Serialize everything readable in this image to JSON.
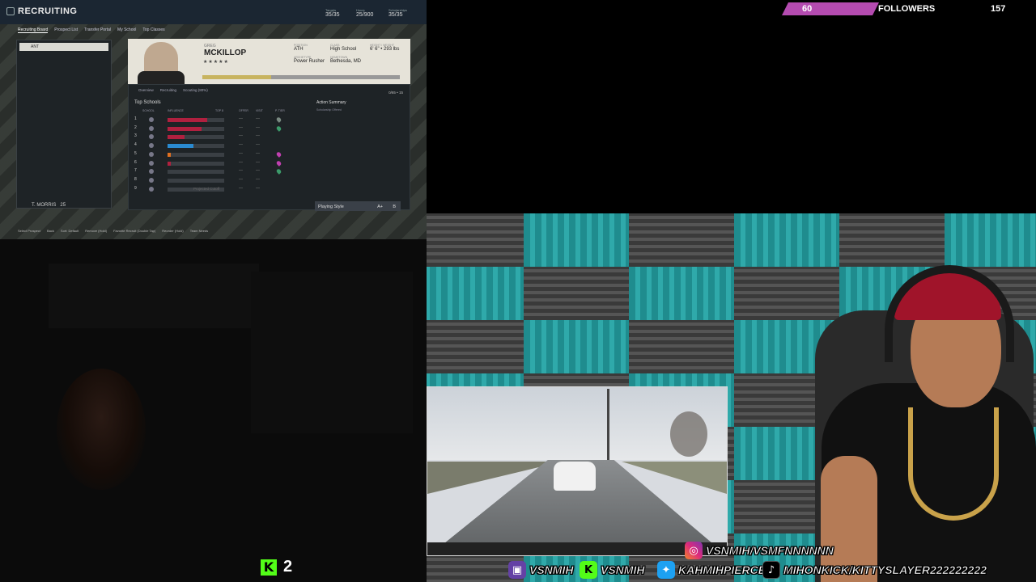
{
  "followers": {
    "current": "60",
    "label": "FOLLOWERS",
    "goal": "157",
    "progress": 0.38,
    "color": "#b44bb0"
  },
  "game": {
    "title": "RECRUITING",
    "stats": [
      {
        "label": "Targets",
        "value": "35/35"
      },
      {
        "label": "Hours",
        "value": "25/900"
      },
      {
        "label": "Scholarships",
        "value": "35/35"
      }
    ],
    "tabs": [
      "Recruiting Board",
      "Prospect List",
      "Transfer Portal",
      "My School",
      "Top Classes"
    ],
    "left_list": {
      "header": "ANT",
      "footer": "T. MORRIS",
      "footer_num": "25"
    },
    "player": {
      "first_name": "GREG",
      "last_name": "MCKILLOP",
      "stars": "★★★★★",
      "fields": [
        {
          "label": "POSITION",
          "value": "ATH"
        },
        {
          "label": "CLASS",
          "value": "High School"
        },
        {
          "label": "HEIGHT / WEIGHT",
          "value": "6' 6\" • 293 lbs"
        },
        {
          "label": "ARCHETYPE",
          "value": "Power Rusher"
        },
        {
          "label": "HOMETOWN",
          "value": "Bethesda, MD"
        }
      ],
      "progress": 0.35
    },
    "detail_tabs": [
      "Overview",
      "Recruiting",
      "Scouting (80%)"
    ],
    "hours": "0/65 • 15",
    "top_schools": "Top Schools",
    "columns": [
      "SCHOOL",
      "INFLUENCE",
      "TOP 8",
      "OFFER",
      "VISIT",
      "P. TIER"
    ],
    "schools": [
      {
        "num": "1",
        "influence": 0.7,
        "color": "#b0203f",
        "pin": "#7a8a82"
      },
      {
        "num": "2",
        "influence": 0.6,
        "color": "#b0203f",
        "pin": "#3c9a6a"
      },
      {
        "num": "3",
        "influence": 0.3,
        "color": "#b0203f",
        "pin": ""
      },
      {
        "num": "4",
        "influence": 0.45,
        "color": "#2a8ad0",
        "pin": ""
      },
      {
        "num": "5",
        "influence": 0.06,
        "color": "#e07020",
        "pin": "#c040b0"
      },
      {
        "num": "6",
        "influence": 0.05,
        "color": "#b0203f",
        "pin": "#c040b0"
      },
      {
        "num": "7",
        "influence": 0.0,
        "color": "#b0203f",
        "pin": "#3c9a6a"
      },
      {
        "num": "8",
        "influence": 0.0,
        "color": "#b0203f",
        "pin": ""
      },
      {
        "num": "9",
        "influence": 0.0,
        "color": "#b0203f",
        "pin": ""
      }
    ],
    "projected_cutoff": "Projected Cutoff",
    "action_summary": "Action Summary",
    "action_sub": "Scholarship Offered",
    "playing_style": {
      "label": "Playing Style",
      "grade1": "A+",
      "grade2": "B"
    },
    "hints": [
      "Select Prospect",
      "Back",
      "Sort: Default",
      "Remove (Hold)",
      "Favorite Recruit (Double Tap)",
      "Reorder (Hold)",
      "Team Needs"
    ]
  },
  "kick_viewers": {
    "icon": "K",
    "count": "2",
    "color": "#53fc18"
  },
  "socials": [
    {
      "platform": "instagram-icon",
      "handle": "VSNMIH/VSMFNNNNNN",
      "color": "#d6249f"
    },
    {
      "platform": "twitch-icon",
      "handle": "VSNMIH",
      "color": "#6441a5"
    },
    {
      "platform": "kick-icon",
      "handle": "VSNMIH",
      "color": "#53fc18"
    },
    {
      "platform": "twitter-icon",
      "handle": "KAHMIHPIERCE",
      "color": "#1da1f2"
    },
    {
      "platform": "tiktok-icon",
      "handle": "MIHONKICK/KITTYSLAYER222222222",
      "color": "#000000"
    }
  ]
}
